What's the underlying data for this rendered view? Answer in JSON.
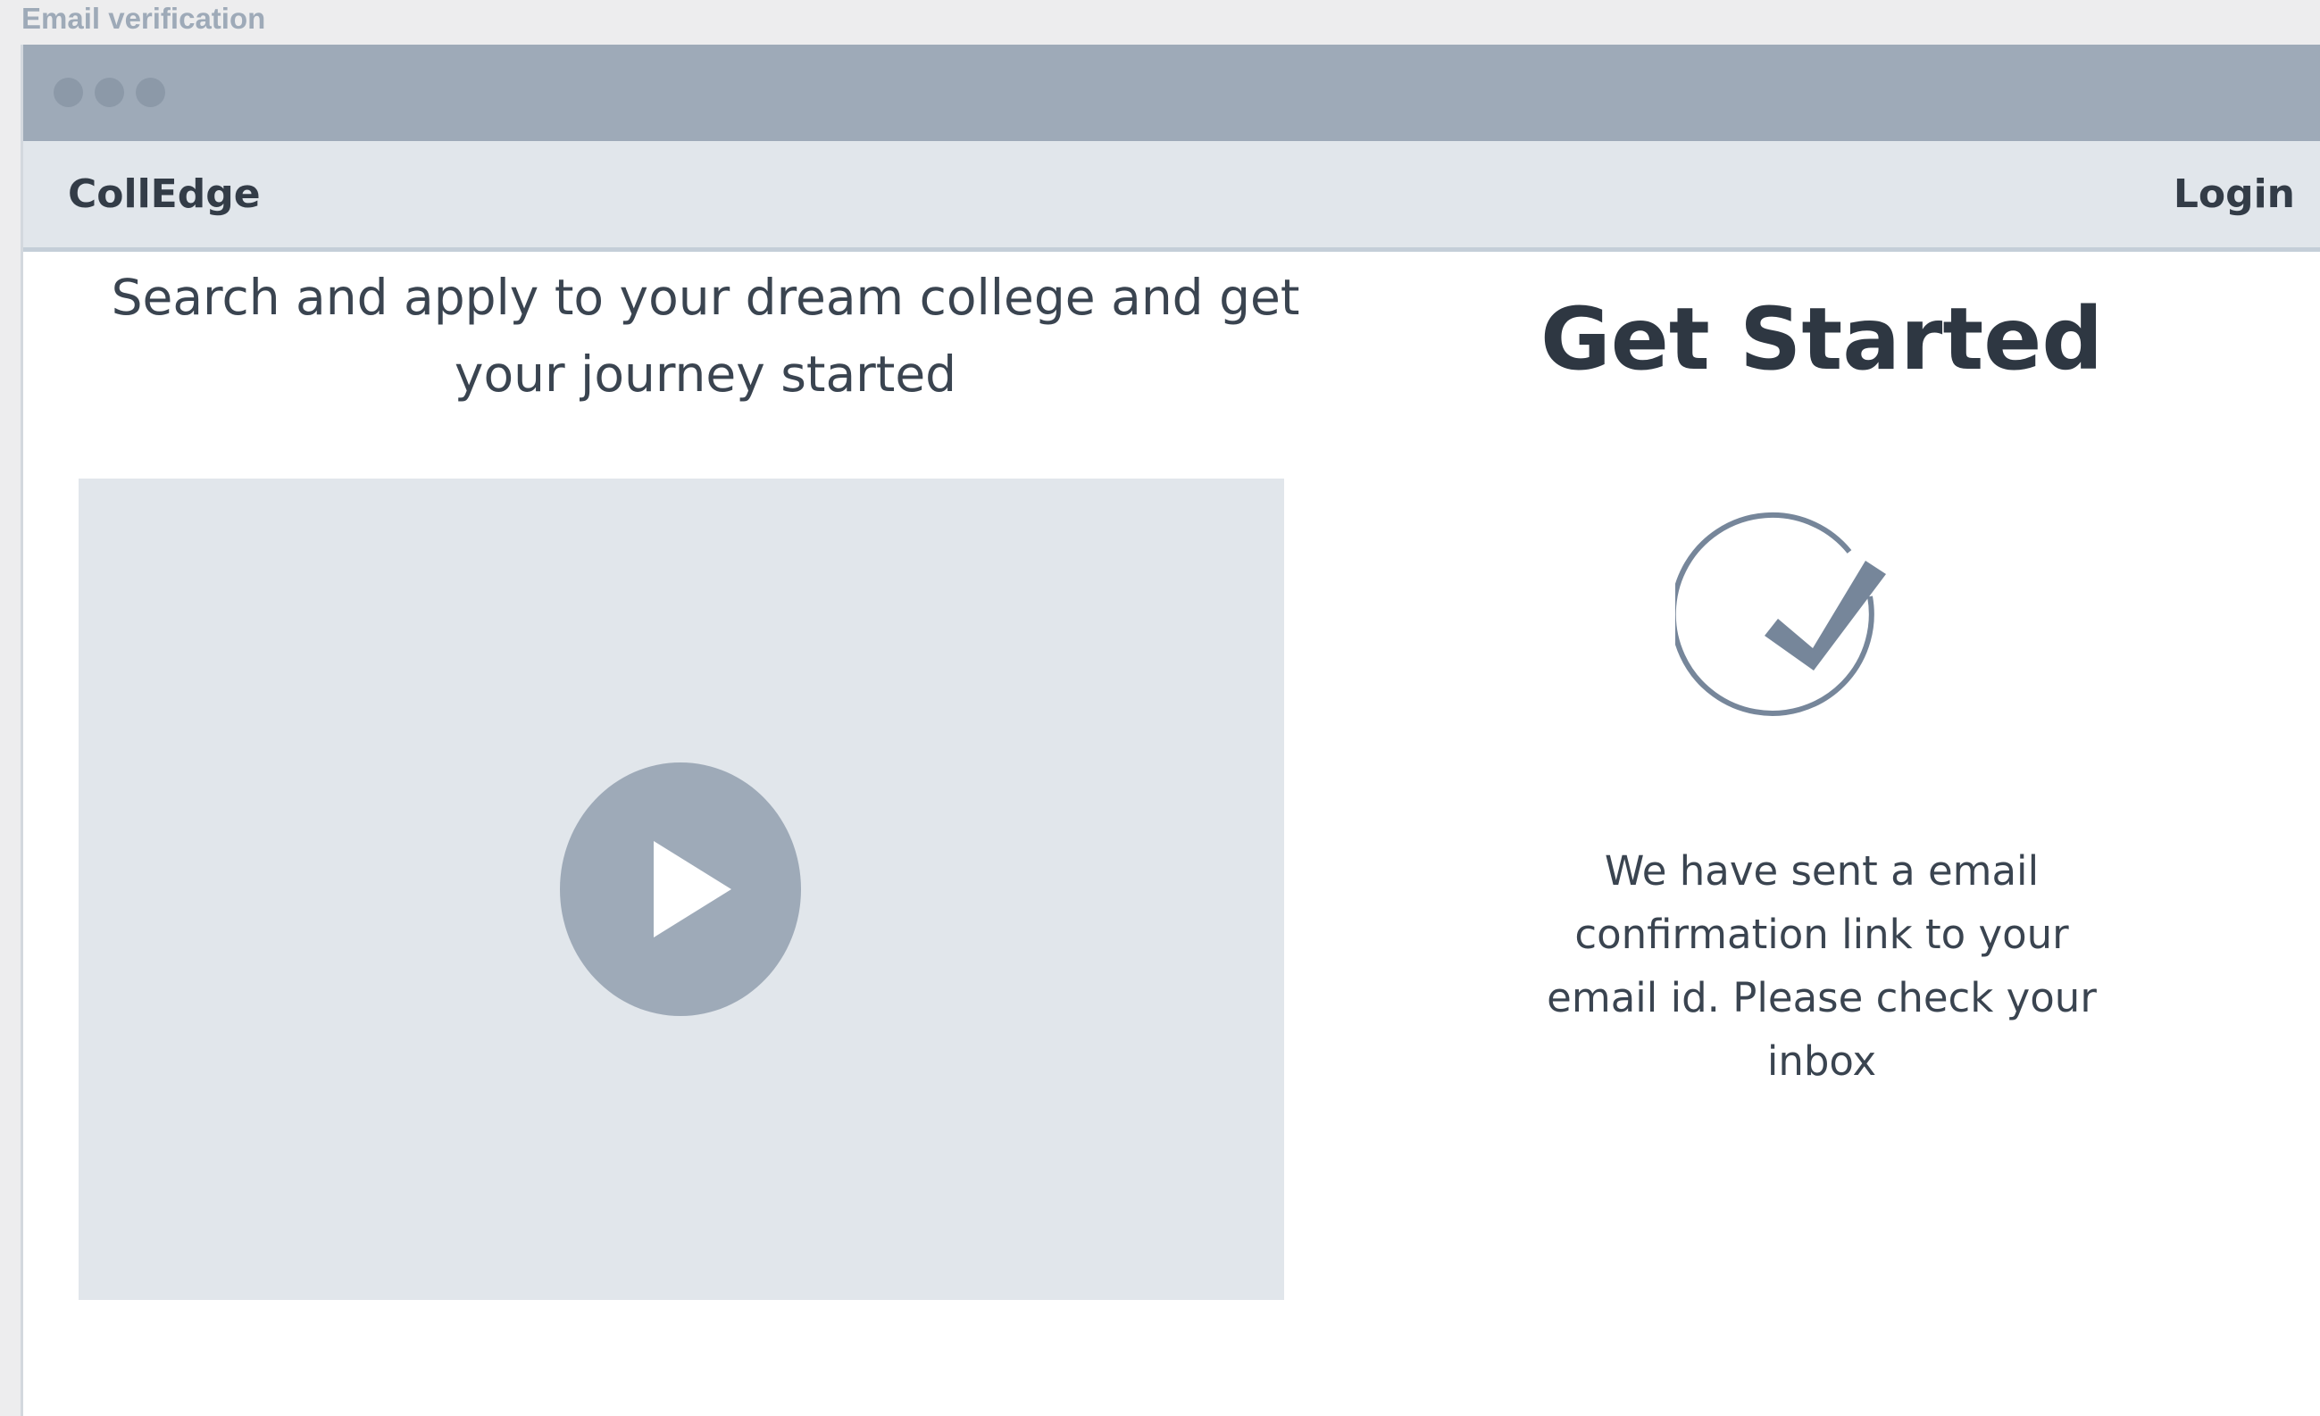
{
  "frame_label": "Email verification",
  "window": {
    "dots": [
      "red-dot",
      "yellow-dot",
      "green-dot"
    ]
  },
  "navbar": {
    "brand": "CollEdge",
    "login_label": "Login"
  },
  "left": {
    "tagline": "Search and apply to your dream college and get your journey started",
    "video": {
      "play_icon": "play-icon"
    }
  },
  "right": {
    "heading": "Get Started",
    "status_icon": "check-circle-icon",
    "message": "We have sent a email confirmation link to your email id. Please check your inbox"
  },
  "colors": {
    "chrome": "#9eaab8",
    "panel": "#e1e6eb",
    "text": "#333c47",
    "icon": "#76869a"
  }
}
